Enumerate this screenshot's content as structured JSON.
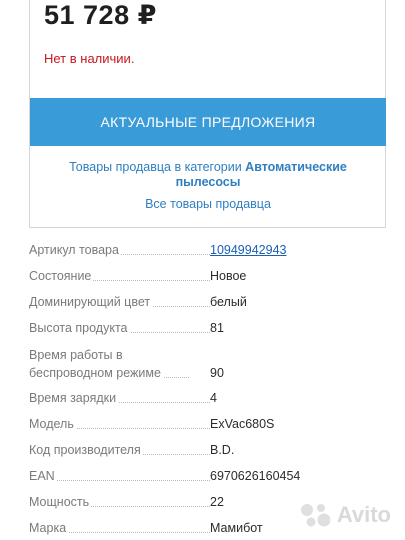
{
  "product": {
    "price": "51 728 ₽",
    "stock_status": "Нет в наличии."
  },
  "actions": {
    "offers_button": "АКТУАЛЬНЫЕ ПРЕДЛОЖЕНИЯ",
    "seller_category_prefix": "Товары продавца в категории ",
    "seller_category_name": "Автоматические пылесосы",
    "all_seller_goods": "Все товары продавца"
  },
  "specs": [
    {
      "label": "Артикул товара",
      "value": "10949942943",
      "link": true
    },
    {
      "label": "Состояние",
      "value": "Новое"
    },
    {
      "label": "Доминирующий цвет",
      "value": "белый"
    },
    {
      "label": "Высота продукта",
      "value": "81"
    },
    {
      "label": "Время работы в беспроводном режиме",
      "value": "90"
    },
    {
      "label": "Время зарядки",
      "value": "4"
    },
    {
      "label": "Модель",
      "value": "ExVac680S"
    },
    {
      "label": "Код производителя",
      "value": "B.D."
    },
    {
      "label": "EAN",
      "value": "6970626160454"
    },
    {
      "label": "Мощность",
      "value": "22"
    },
    {
      "label": "Марка",
      "value": "Мамибот"
    }
  ],
  "watermark": {
    "text": "Avito",
    "icon": "avito-logo-icon"
  }
}
